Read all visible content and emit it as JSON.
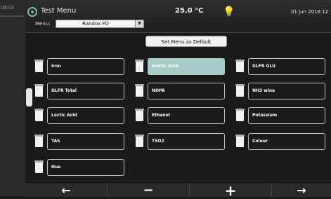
{
  "left_panel": {
    "fragment_text": "09:03"
  },
  "header": {
    "app_title": "Test Menu",
    "temperature": "25.0 °C",
    "date": "01 Jun 2016  12",
    "menu_label": "Menu:",
    "menu_value": "Randox FD",
    "bulb_icon": "lightbulb-icon"
  },
  "set_default_label": "Set Menu as Default",
  "tests": [
    [
      "Iron",
      "Acetic Acid",
      "GLFR GLU"
    ],
    [
      "GLFR Total",
      "NOPA",
      "NH3 wine"
    ],
    [
      "Lactic Acid",
      "Ethanol",
      "Potassium"
    ],
    [
      "TAS",
      "TSO2",
      "Colour"
    ],
    [
      "Hue"
    ]
  ],
  "selected_test": "Acetic Acid",
  "footer": {
    "prev_icon": "←",
    "minus_icon": "−",
    "plus_icon": "+",
    "next_icon": "→"
  },
  "colors": {
    "accent": "#a7ccc7",
    "background": "#1a1a1a"
  }
}
